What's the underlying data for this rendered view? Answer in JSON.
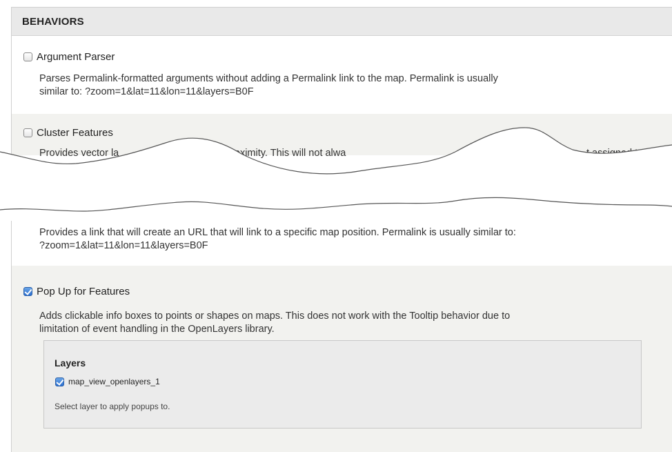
{
  "section": {
    "title": "BEHAVIORS"
  },
  "behaviors": [
    {
      "label": "Argument Parser",
      "checked": false,
      "description": [
        "Parses Permalink-formatted arguments without adding a Permalink link to the map. Permalink is usually",
        "similar to: ?zoom=1&lat=11&lon=11&layers=B0F"
      ]
    },
    {
      "label": "Cluster Features",
      "checked": false,
      "description_fragments": [
        "Provides vector la",
        "proximity. This will not alwa",
        "t assigned t"
      ]
    },
    {
      "label": "",
      "checked": false,
      "description": [
        "Provides a link that will create an URL that will link to a specific map position. Permalink is usually similar to:",
        "?zoom=1&lat=11&lon=11&layers=B0F"
      ]
    },
    {
      "label": "Pop Up for Features",
      "checked": true,
      "description": [
        "Adds clickable info boxes to points or shapes on maps. This does not work with the Tooltip behavior due to",
        "limitation of event handling in the OpenLayers library."
      ],
      "settings": {
        "title": "Layers",
        "option": {
          "label": "map_view_openlayers_1",
          "checked": true
        },
        "help": "Select layer to apply popups to."
      }
    }
  ],
  "colors": {
    "header_bg": "#e9e9e9",
    "row_alt_bg": "#f2f2ef",
    "checkbox_checked": "#2c6fcf",
    "subbox_bg": "#ebebeb"
  }
}
